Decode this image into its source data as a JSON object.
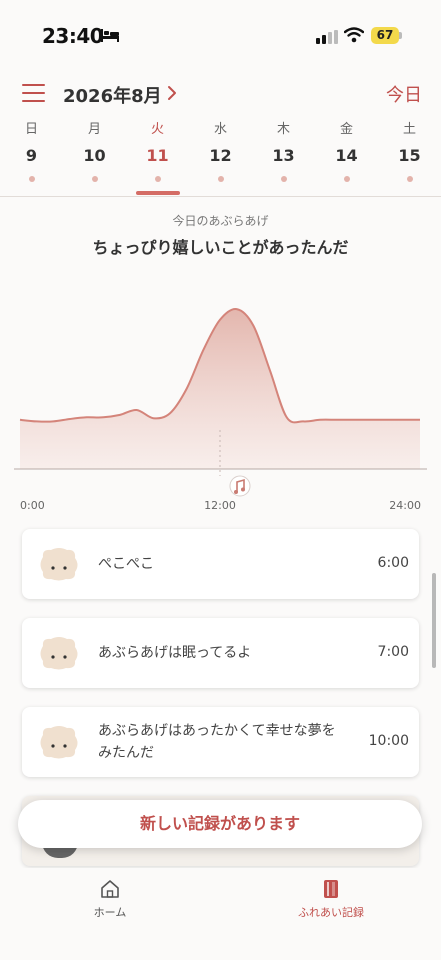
{
  "status_bar": {
    "time": "23:40",
    "battery": "67"
  },
  "header": {
    "month_title": "2026年8月",
    "today_label": "今日"
  },
  "week": [
    {
      "weekday": "日",
      "date": "9"
    },
    {
      "weekday": "月",
      "date": "10"
    },
    {
      "weekday": "火",
      "date": "11",
      "selected": true
    },
    {
      "weekday": "水",
      "date": "12"
    },
    {
      "weekday": "木",
      "date": "13"
    },
    {
      "weekday": "金",
      "date": "14"
    },
    {
      "weekday": "土",
      "date": "15"
    }
  ],
  "chart": {
    "caption": "今日のあぶらあげ",
    "heading": "ちょっぴり嬉しいことがあったんだ"
  },
  "chart_data": {
    "type": "area",
    "x_ticks": [
      "0:00",
      "12:00",
      "24:00"
    ],
    "xlim": [
      0,
      24
    ],
    "x": [
      0,
      1,
      2,
      3,
      4,
      5,
      6,
      7,
      8,
      9,
      10,
      11,
      12,
      13,
      14,
      15,
      16,
      17,
      18,
      19,
      20,
      21,
      22,
      23,
      24
    ],
    "y": [
      0.6,
      0.58,
      0.58,
      0.61,
      0.63,
      0.63,
      0.66,
      0.72,
      0.62,
      0.68,
      0.98,
      1.45,
      1.82,
      1.95,
      1.75,
      1.2,
      0.63,
      0.58,
      0.6,
      0.6,
      0.6,
      0.6,
      0.6,
      0.6,
      0.6
    ],
    "color": "#d4847a",
    "marker_icon": "music-note-icon"
  },
  "records": [
    {
      "text": "ぺこぺこ",
      "time": "6:00"
    },
    {
      "text": "あぶらあげは眠ってるよ",
      "time": "7:00"
    },
    {
      "text": "あぶらあげはあったかくて幸せな夢を\nみたんだ",
      "time": "10:00"
    }
  ],
  "new_records_label": "新しい記録があります",
  "tabs": [
    {
      "label": "ホーム",
      "icon": "home-icon",
      "active": false
    },
    {
      "label": "ふれあい記録",
      "icon": "notebook-icon",
      "active": true
    }
  ],
  "colors": {
    "accent": "#c0504d",
    "fill": "#e9c2bb",
    "dot": "#e3b3ab"
  }
}
